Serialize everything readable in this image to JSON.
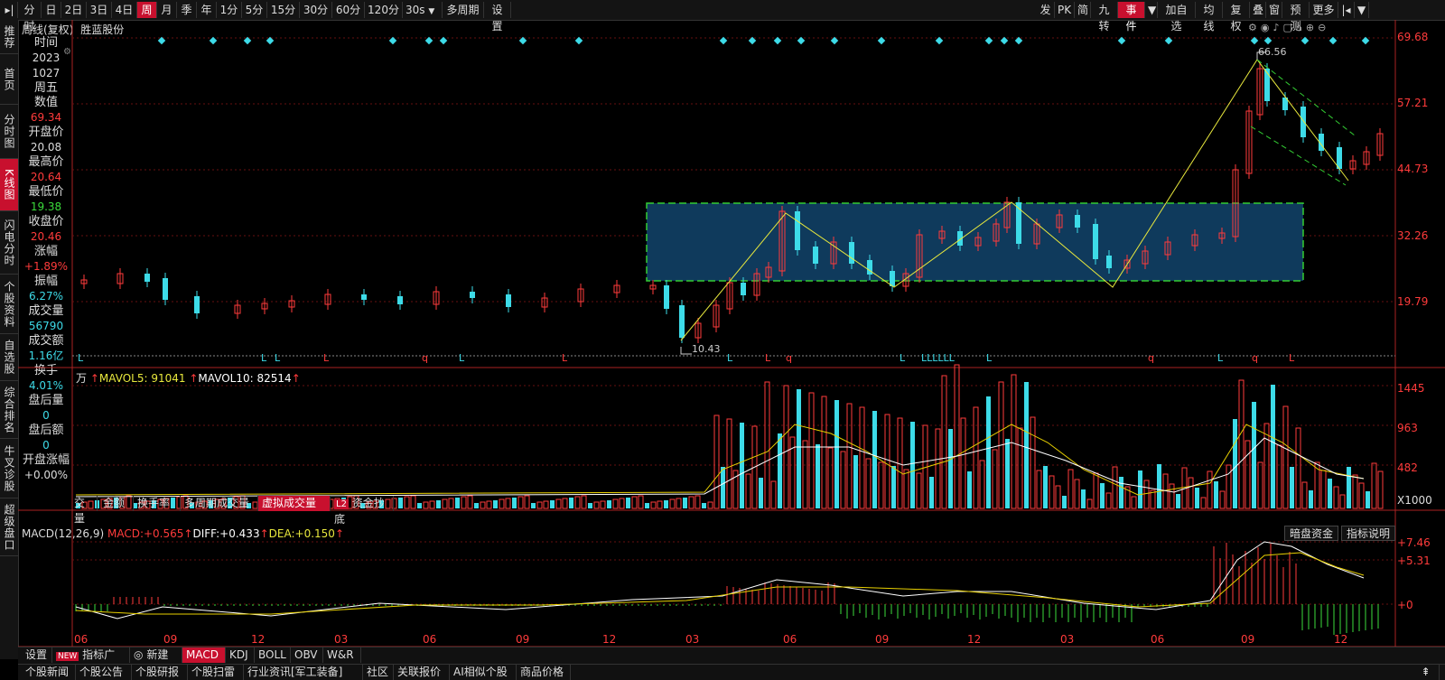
{
  "toolbar": {
    "left": [
      "分时",
      "日",
      "2日",
      "3日",
      "4日",
      "周",
      "月",
      "季",
      "年",
      "1分",
      "5分",
      "15分",
      "30分",
      "60分",
      "120分",
      "30s"
    ],
    "active": "周",
    "multi_period": "多周期",
    "settings": "设置",
    "right": [
      "发",
      "PK",
      "简",
      "九转",
      "事件",
      "加自选",
      "均线",
      "复权",
      "叠",
      "窗",
      "预测",
      "更多"
    ]
  },
  "left_tabs": [
    "推荐",
    "首页",
    "分时图",
    "K线图",
    "闪电分时",
    "个股资料",
    "自选股",
    "综合排名",
    "牛叉诊股",
    "超级盘口"
  ],
  "left_tab_active": "K线图",
  "chart_title": "周线(复权)",
  "stock_name": "胜蓝股份",
  "info": [
    {
      "label": "时间",
      "value": "2023",
      "color": "#dddddd"
    },
    {
      "label": "",
      "value": "1027",
      "color": "#dddddd"
    },
    {
      "label": "周五",
      "value": "",
      "color": "#dddddd"
    },
    {
      "label": "数值",
      "value": "69.34",
      "color": "#ff3b3b"
    },
    {
      "label": "开盘价",
      "value": "20.08",
      "color": "#dddddd"
    },
    {
      "label": "最高价",
      "value": "20.64",
      "color": "#ff3b3b"
    },
    {
      "label": "最低价",
      "value": "19.38",
      "color": "#3bdb3b"
    },
    {
      "label": "收盘价",
      "value": "20.46",
      "color": "#ff3b3b"
    },
    {
      "label": "涨幅",
      "value": "+1.89%",
      "color": "#ff3b3b"
    },
    {
      "label": "振幅",
      "value": "6.27%",
      "color": "#3ddbe8"
    },
    {
      "label": "成交量",
      "value": "56790",
      "color": "#3ddbe8"
    },
    {
      "label": "成交额",
      "value": "1.16亿",
      "color": "#3ddbe8"
    },
    {
      "label": "换手",
      "value": "4.01%",
      "color": "#3ddbe8"
    },
    {
      "label": "盘后量",
      "value": "0",
      "color": "#3ddbe8"
    },
    {
      "label": "盘后额",
      "value": "0",
      "color": "#3ddbe8"
    },
    {
      "label": "开盘涨幅",
      "value": "+0.00%",
      "color": "#dddddd"
    }
  ],
  "price_axis": [
    "69.68",
    "57.21",
    "44.73",
    "32.26",
    "19.79"
  ],
  "annotations": {
    "high": "66.56",
    "low": "10.43"
  },
  "volume": {
    "unit_label": "万",
    "mavol5_label": "MAVOL5:",
    "mavol5_value": "91041",
    "mavol10_label": "MAVOL10:",
    "mavol10_value": "82514",
    "axis": [
      "1445",
      "963",
      "482",
      "X1000"
    ]
  },
  "mid_tabs": [
    "交量",
    "金额",
    "换手率",
    "多周期成交量",
    "虚拟成交量",
    "资金抄底"
  ],
  "mid_active": "虚拟成交量",
  "mid_badge": "L2",
  "macd": {
    "label": "MACD(12,26,9)",
    "macd_label": "MACD:",
    "macd_value": "+0.565",
    "diff_label": "DIFF:",
    "diff_value": "+0.433",
    "dea_label": "DEA:",
    "dea_value": "+0.150",
    "axis": [
      "+7.46",
      "+5.31",
      "+0"
    ],
    "btn_dark": "暗盘资金",
    "btn_explain": "指标说明"
  },
  "x_axis": [
    "06",
    "09",
    "12",
    "03",
    "06",
    "09",
    "12",
    "03",
    "06",
    "09",
    "12",
    "03",
    "06",
    "09",
    "12"
  ],
  "bottom_tabs1": [
    "设置",
    "指标广场",
    "新建",
    "MACD",
    "KDJ",
    "BOLL",
    "OBV",
    "W&R"
  ],
  "bottom_active": "MACD",
  "new_badge": "NEW",
  "bottom_tabs2": [
    "个股新闻",
    "个股公告",
    "个股研报",
    "个股扫雷",
    "行业资讯[军工装备]",
    "社区",
    "关联报价",
    "AI相似个股",
    "商品价格"
  ],
  "markers_top": [
    {
      "text": "L",
      "color": "#3ddbe8"
    },
    {
      "text": "L",
      "color": "#3ddbe8"
    },
    {
      "text": "L",
      "color": "#3ddbe8"
    },
    {
      "text": "L",
      "color": "#ff3b3b"
    },
    {
      "text": "q",
      "color": "#ff3b3b"
    },
    {
      "text": "L",
      "color": "#3ddbe8"
    },
    {
      "text": "L",
      "color": "#ff3b3b"
    },
    {
      "text": "L",
      "color": "#3ddbe8"
    },
    {
      "text": "L",
      "color": "#ff3b3b"
    },
    {
      "text": "q",
      "color": "#ff3b3b"
    },
    {
      "text": "L",
      "color": "#3ddbe8"
    },
    {
      "text": "LLLLLL",
      "color": "#3ddbe8"
    },
    {
      "text": "L",
      "color": "#3ddbe8"
    },
    {
      "text": "q",
      "color": "#ff3b3b"
    },
    {
      "text": "L",
      "color": "#3ddbe8"
    },
    {
      "text": "q",
      "color": "#ff3b3b"
    },
    {
      "text": "L",
      "color": "#ff3b3b"
    }
  ],
  "colors": {
    "up": "#ff3b3b",
    "down": "#3ddbe8",
    "accent": "#c8102e",
    "box": "#0f3a5c",
    "box_border": "#33cc33",
    "ma_white": "#ffffff",
    "ma_yellow": "#e8d000"
  }
}
